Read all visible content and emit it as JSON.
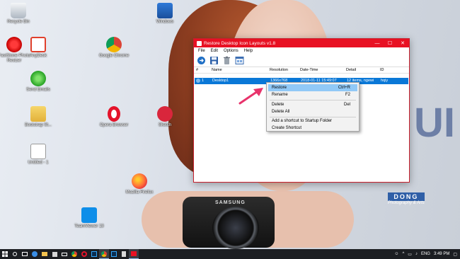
{
  "desktop": {
    "icons": [
      {
        "label": "Recycle Bin"
      },
      {
        "label": "FastStone Photo Resizer"
      },
      {
        "label": "AnyDesk"
      },
      {
        "label": "Send Emails"
      },
      {
        "label": "Bootstrap St..."
      },
      {
        "label": "Untitled - 1"
      },
      {
        "label": "Google Chrome"
      },
      {
        "label": "Opera Browser"
      },
      {
        "label": "Mozilla Firefox"
      },
      {
        "label": "TeamViewer 13"
      },
      {
        "label": "Windows"
      },
      {
        "label": "Sketch"
      }
    ],
    "watermark": {
      "logo": "DONG",
      "sub": "Photography & Arts"
    },
    "camera_brand": "SAMSUNG"
  },
  "window": {
    "title": "Restore Desktop Icon Layouts v1.8",
    "controls": {
      "minimize": "—",
      "maximize": "☐",
      "close": "✕"
    },
    "menu": [
      "File",
      "Edit",
      "Options",
      "Help"
    ],
    "columns": [
      "#",
      "Name",
      "Resolution",
      "Date-Time",
      "Detail",
      "ID"
    ],
    "rows": [
      {
        "num": "1",
        "name": "Desktop1",
        "resolution": "1366x768",
        "datetime": "2018-01-11 15:49:07",
        "detail": "12 items, ngewi",
        "id": "hqiy"
      }
    ]
  },
  "context_menu": {
    "items": [
      {
        "label": "Restore",
        "shortcut": "Ctrl+R"
      },
      {
        "label": "Rename",
        "shortcut": "F2"
      },
      {
        "label": "Delete",
        "shortcut": "Del"
      },
      {
        "label": "Delete All",
        "shortcut": ""
      },
      {
        "label": "Add a shortcut to Startup Folder",
        "shortcut": ""
      },
      {
        "label": "Create Shortcut",
        "shortcut": ""
      }
    ]
  },
  "taskbar": {
    "language": "ENG",
    "time": "3:49 PM"
  },
  "colors": {
    "titlebar": "#e81123",
    "selection": "#0a78d7",
    "menu_highlight": "#91c9f7",
    "taskbar": "#1c1e22",
    "arrow": "#e8336b"
  }
}
